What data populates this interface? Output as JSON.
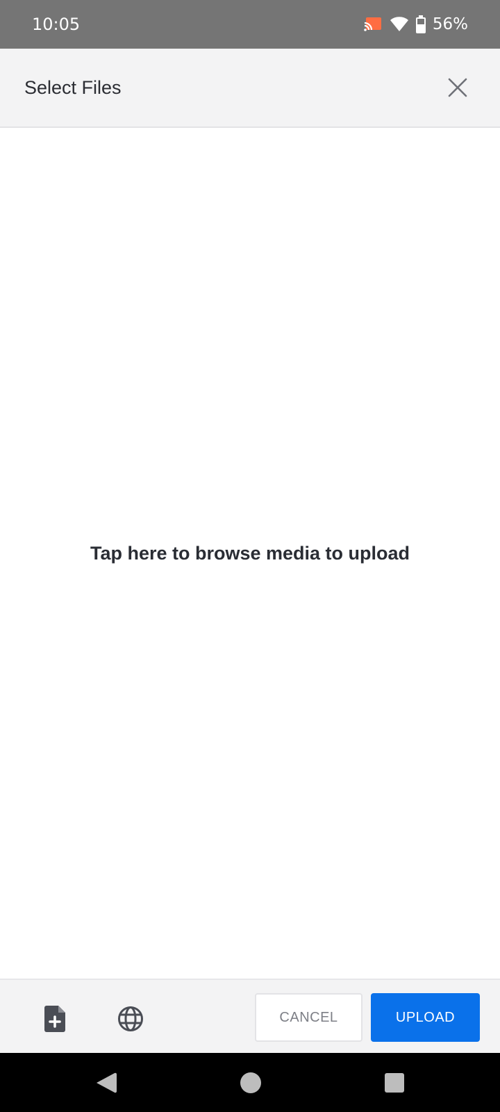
{
  "status_bar": {
    "time": "10:05",
    "battery_percent": "56%",
    "icons": [
      "cast-icon",
      "wifi-icon",
      "battery-icon"
    ],
    "cast_color": "#ff6d42"
  },
  "header": {
    "title": "Select Files",
    "close_icon": "close-icon"
  },
  "main": {
    "prompt": "Tap here to browse media to upload"
  },
  "footer": {
    "icons": [
      "add-file-icon",
      "globe-icon"
    ],
    "cancel_label": "CANCEL",
    "upload_label": "UPLOAD",
    "upload_color": "#0a71ea"
  },
  "nav_bar": {
    "icons": [
      "back-icon",
      "home-icon",
      "recents-icon"
    ]
  }
}
